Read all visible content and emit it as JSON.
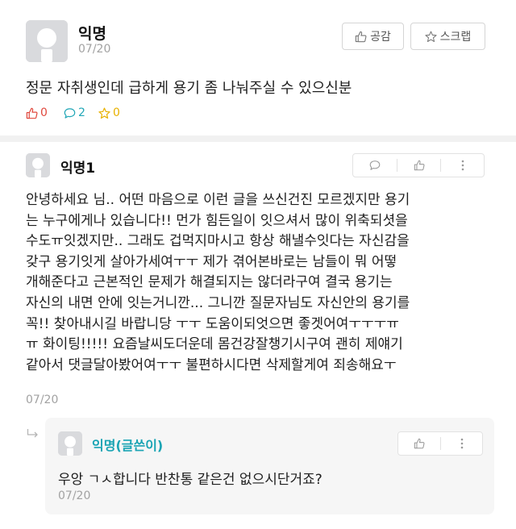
{
  "post": {
    "author": "익명",
    "date": "07/20",
    "like_label": "공감",
    "scrap_label": "스크랩",
    "text": "정문 자취생인데 급하게 용기 좀 나눠주실 수 있으신분",
    "likes": "0",
    "comments": "2",
    "scraps": "0"
  },
  "comment": {
    "author": "익명1",
    "lines": [
      "안녕하세요 님.. 어떤 마음으로 이런 글을 쓰신건진 모르겠지만 용기",
      "는 누구에게나 있습니다!! 먼가 힘든일이 잇으셔서 많이 위축되셧을",
      "수도ㅠ잇겠지만.. 그래도 겁먹지마시고 항상 해낼수잇다는 자신감을",
      "갖구 용기잇게 살아가세여ㅜㅜ 제가 겪어본바로는 남들이 뭐 어떻",
      "개해준다고 근본적인 문제가 해결되지는 않더라구여 결국 용기는",
      "자신의 내면 안에 잇는거니깐... 그니깐 질문자님도 자신안의 용기를",
      "꼭!! 찾아내시길 바랍니당 ㅜㅜ 도움이되엇으면 좋겟어여ㅜㅜㅜㅠ",
      "ㅠ 화이팅!!!!! 요즘날씨도더운데 몸건강잘챙기시구여 괜히 제얘기",
      "같아서 댓글달아봤어여ㅜㅜ 불편하시다면 삭제할게여 죄송해요ㅜ"
    ],
    "date": "07/20"
  },
  "reply": {
    "author": "익명(글쓴이)",
    "text": "우앙 ㄱㅅ합니다 반찬통 같은건 없으시단거죠?",
    "date": "07/20"
  },
  "colors": {
    "like": "#e0483d",
    "comment": "#22a7b7",
    "scrap": "#e8b100",
    "writer": "#1aa4b4",
    "muted": "#a2a2a2"
  },
  "icons": {
    "avatar": "anonymous-avatar",
    "like": "thumbs-up-icon",
    "comment": "speech-bubble-icon",
    "scrap": "star-icon",
    "more": "more-vertical-icon",
    "reply_arrow": "reply-arrow-icon"
  }
}
